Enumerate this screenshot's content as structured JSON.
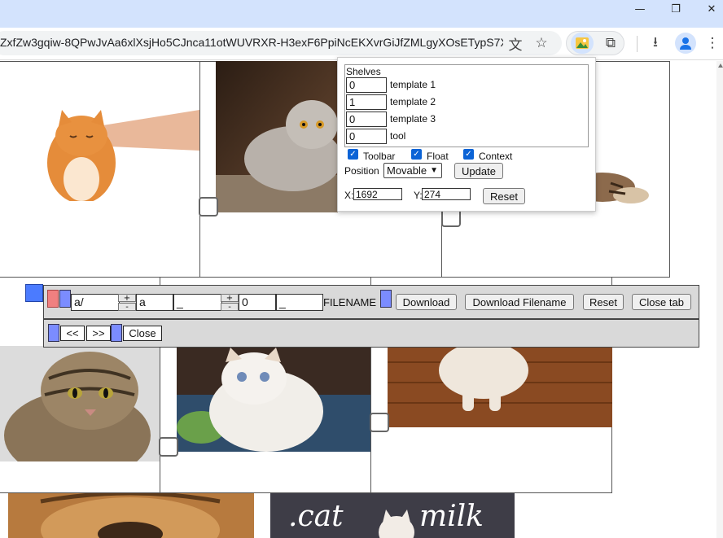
{
  "browser": {
    "url": "ZxfZw3gqiw-8QPwJvAa6xlXsjHo5CJnca11otWUVRXR-H3exF6PpiNcEKXvrGiJfZMLgyXOsETypS7XQX...",
    "window_controls": {
      "minimize": "—",
      "restore": "❐",
      "close": "✕"
    },
    "icons": {
      "translate": "文",
      "star": "☆",
      "extensions": "⧉",
      "download": "⭳",
      "menu": "⋮"
    }
  },
  "popup": {
    "shelves_title": "Shelves",
    "shelves": [
      {
        "value": "0",
        "label": "template 1"
      },
      {
        "value": "1",
        "label": "template 2"
      },
      {
        "value": "0",
        "label": "template 3"
      },
      {
        "value": "0",
        "label": "tool"
      }
    ],
    "checkboxes": [
      {
        "label": "Toolbar",
        "checked": true
      },
      {
        "label": "Float",
        "checked": true
      },
      {
        "label": "Context",
        "checked": true
      }
    ],
    "position_label": "Position",
    "position_value": "Movable",
    "update_label": "Update",
    "x_label": "X:",
    "x_value": "1692",
    "y_label": "Y:",
    "y_value": "274",
    "reset_label": "Reset"
  },
  "bar1": {
    "field1": "a/",
    "field2": "a",
    "field3": "_",
    "field4": "0",
    "field5": "_",
    "step_plus": "+",
    "step_minus": "-",
    "filename_label": "FILENAME",
    "download_label": "Download",
    "download_filename_label": "Download Filename",
    "reset_label": "Reset",
    "close_tab_label": "Close tab"
  },
  "bar2": {
    "prev_label": "<<",
    "next_label": ">>",
    "close_label": "Close"
  },
  "gallery": {
    "milk_banner_left": ".cat",
    "milk_banner_right": "milk"
  },
  "colors": {
    "chrome_frame": "#d3e3fd",
    "accent_blue": "#1a73e8",
    "handle_blue": "#7b8cff",
    "handle_red": "#f08080"
  }
}
